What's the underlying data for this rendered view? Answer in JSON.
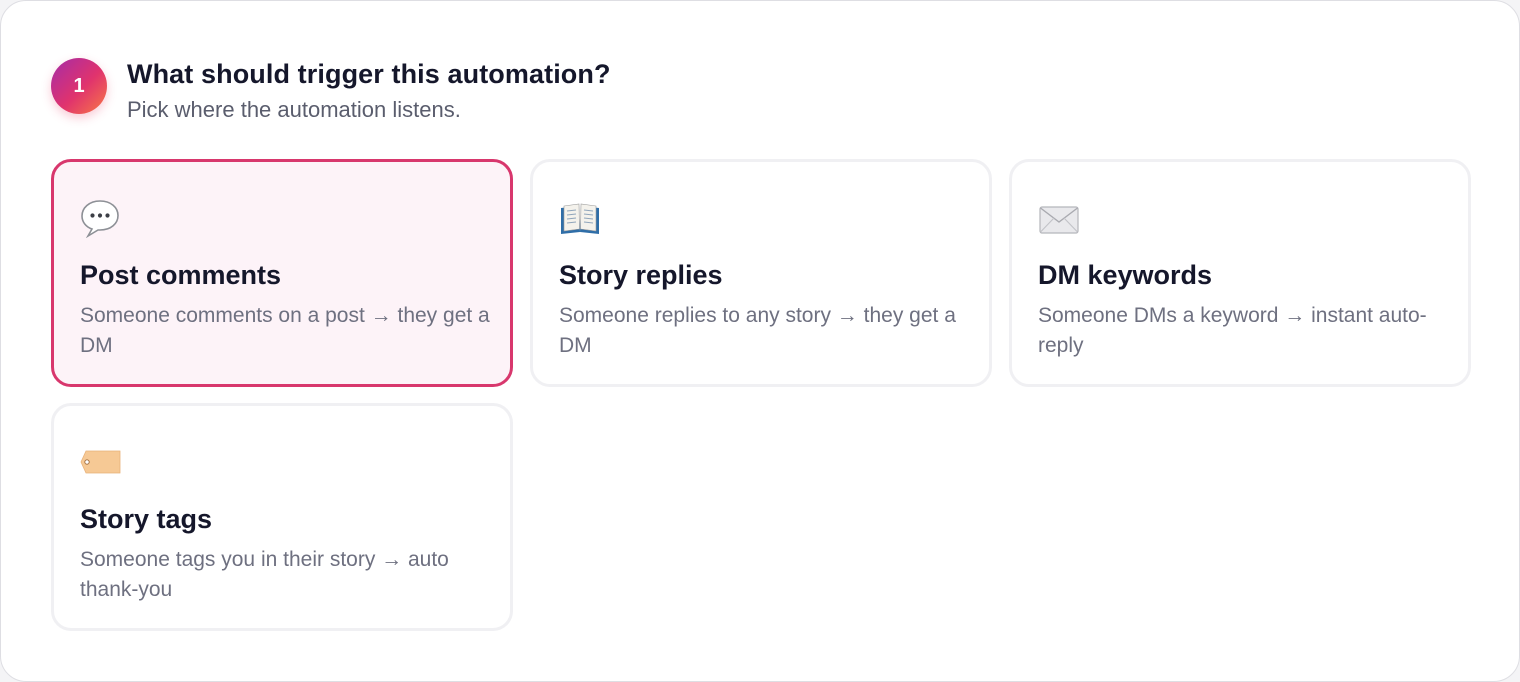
{
  "step": {
    "number": "1",
    "title": "What should trigger this automation?",
    "subtitle": "Pick where the automation listens."
  },
  "options": [
    {
      "icon": "speech-bubble-icon",
      "title": "Post comments",
      "description": "Someone comments on a post → they get a DM",
      "selected": true
    },
    {
      "icon": "open-book-icon",
      "title": "Story replies",
      "description": "Someone replies to any story → they get a DM",
      "selected": false
    },
    {
      "icon": "envelope-icon",
      "title": "DM keywords",
      "description": "Someone DMs a keyword → instant auto-reply",
      "selected": false
    },
    {
      "icon": "tag-icon",
      "title": "Story tags",
      "description": "Someone tags you in their story → auto thank-you",
      "selected": false
    }
  ],
  "colors": {
    "selected_border": "#d8376d",
    "selected_background": "#fdf3f8",
    "card_border": "#f0f0f3",
    "badge_gradient_start": "#a52ca8",
    "badge_gradient_end": "#f97a45"
  }
}
